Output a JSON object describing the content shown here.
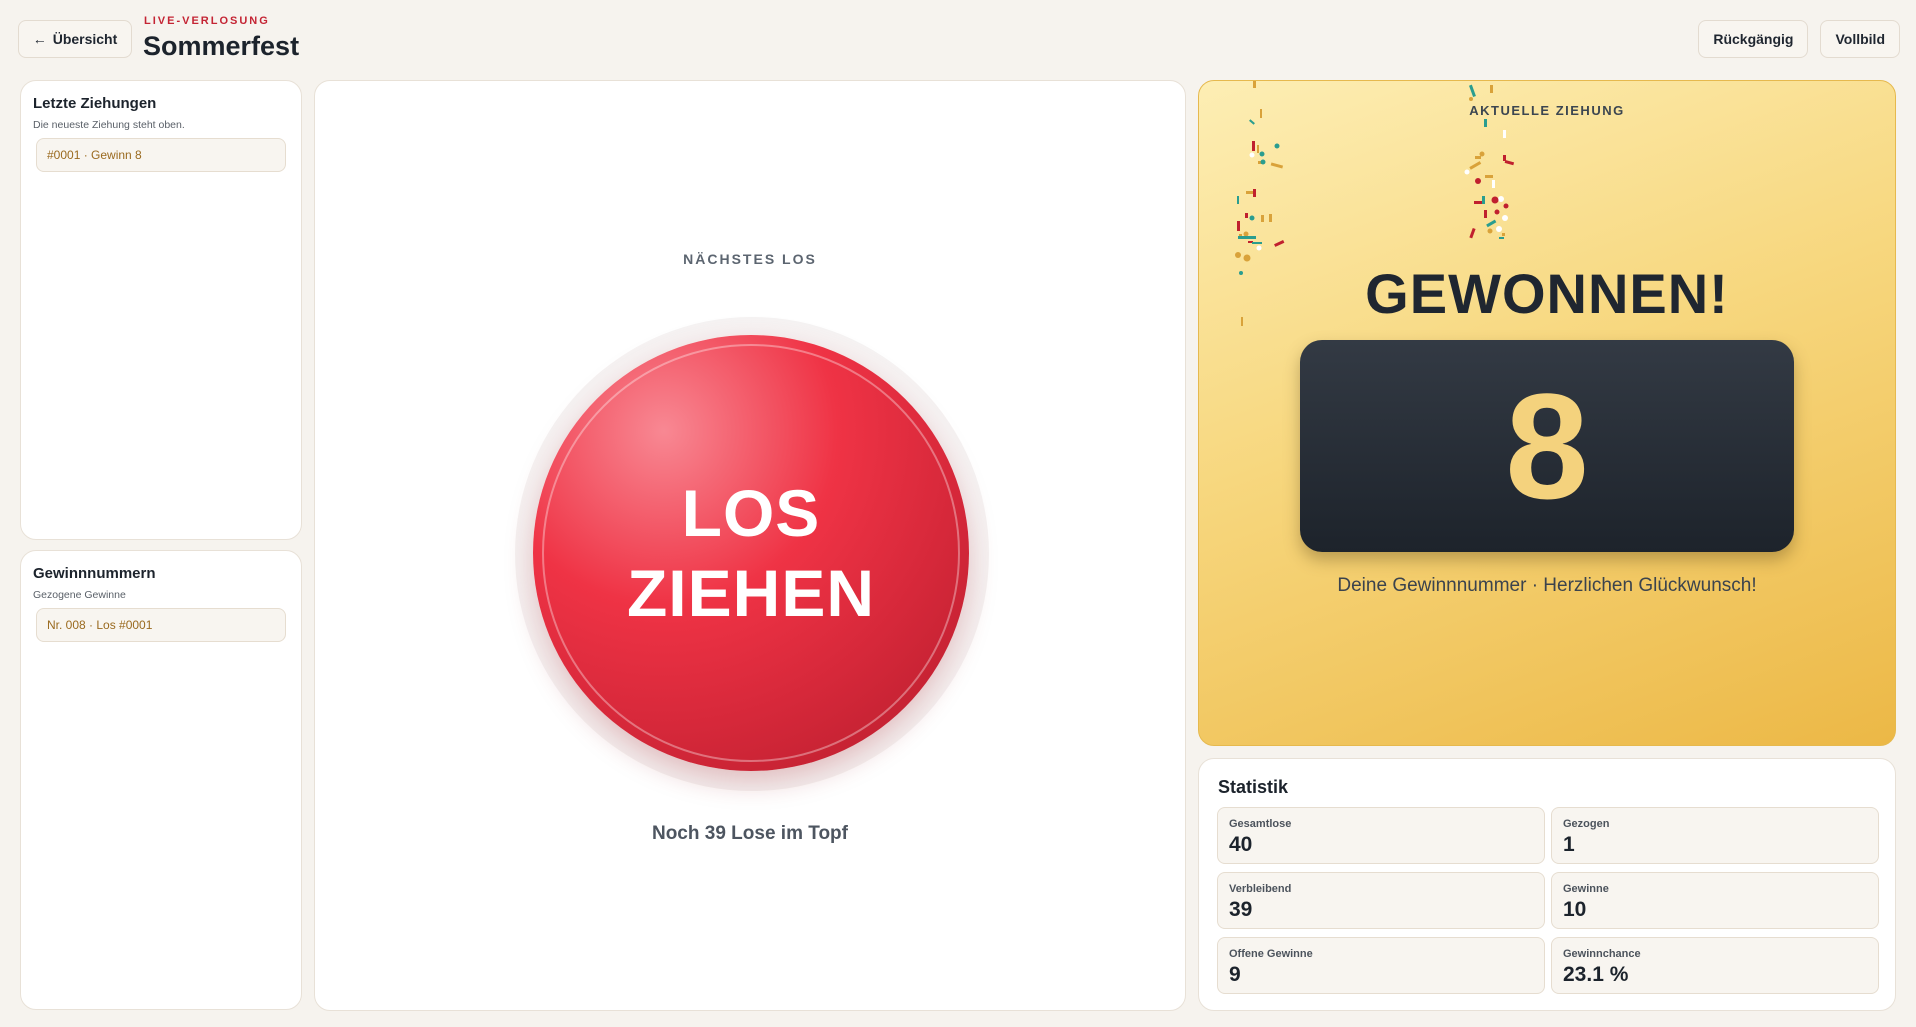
{
  "header": {
    "back_label": "Übersicht",
    "eyebrow": "LIVE-VERLOSUNG",
    "title": "Sommerfest",
    "undo_label": "Rückgängig",
    "fullscreen_label": "Vollbild"
  },
  "recent": {
    "title": "Letzte Ziehungen",
    "subtitle": "Die neueste Ziehung steht oben.",
    "items": [
      "#0001  ·  Gewinn 8"
    ]
  },
  "winners": {
    "title": "Gewinnnummern",
    "subtitle": "Gezogene Gewinne",
    "items": [
      "Nr. 008  ·  Los #0001"
    ]
  },
  "draw": {
    "label": "NÄCHSTES LOS",
    "button_line1": "LOS",
    "button_line2": "ZIEHEN",
    "remaining_text": "Noch 39 Lose im Topf"
  },
  "current": {
    "label": "AKTUELLE ZIEHUNG",
    "headline": "GEWONNEN!",
    "number": "8",
    "message": "Deine Gewinnnummer · Herzlichen Glückwunsch!"
  },
  "stats": {
    "title": "Statistik",
    "items": [
      {
        "label": "Gesamtlose",
        "value": "40"
      },
      {
        "label": "Gezogen",
        "value": "1"
      },
      {
        "label": "Verbleibend",
        "value": "39"
      },
      {
        "label": "Gewinne",
        "value": "10"
      },
      {
        "label": "Offene Gewinne",
        "value": "9"
      },
      {
        "label": "Gewinnchance",
        "value": "23.1 %"
      }
    ]
  },
  "colors": {
    "accent_red": "#e8303f",
    "gold": "#f4d27d",
    "dark": "#1d232b"
  }
}
